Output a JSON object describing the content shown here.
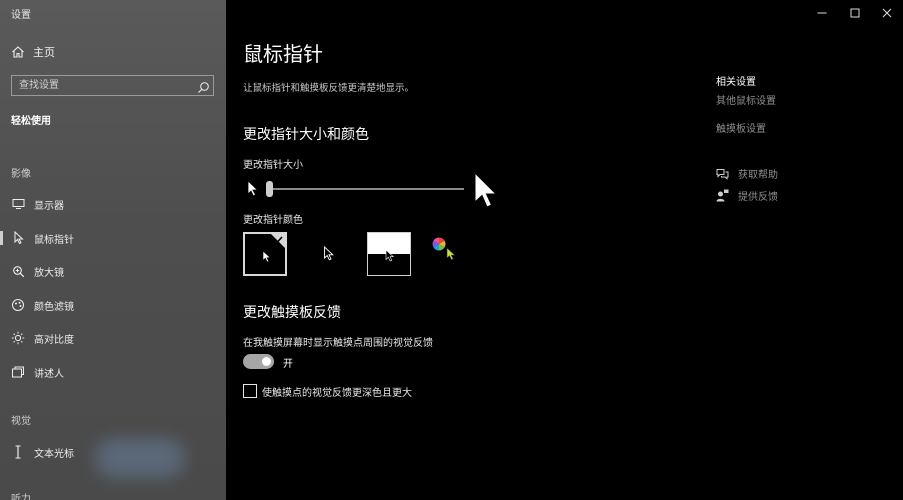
{
  "window": {
    "title": "设置",
    "controls": {
      "minimize": "minimize-icon",
      "maximize": "maximize-icon",
      "close": "close-icon"
    }
  },
  "sidebar": {
    "home": "主页",
    "search_placeholder": "查找设置",
    "section": "轻松使用",
    "groups": [
      {
        "label": "影像",
        "items": [
          {
            "label": "显示器",
            "icon": "monitor-icon"
          },
          {
            "label": "鼠标指针",
            "icon": "mouse-pointer-icon",
            "active": true
          },
          {
            "label": "放大镜",
            "icon": "magnifier-icon"
          },
          {
            "label": "颜色滤镜",
            "icon": "color-filter-icon"
          },
          {
            "label": "高对比度",
            "icon": "high-contrast-icon"
          },
          {
            "label": "讲述人",
            "icon": "narrator-icon"
          }
        ]
      },
      {
        "label": "视觉",
        "items": [
          {
            "label": "文本光标",
            "icon": "text-cursor-icon"
          }
        ]
      },
      {
        "label": "听力",
        "items": []
      }
    ]
  },
  "main": {
    "title": "鼠标指针",
    "description": "让鼠标指针和触摸板反馈更清楚地显示。",
    "size_section": {
      "heading": "更改指针大小和颜色",
      "size_label": "更改指针大小",
      "size_level": 0.0,
      "color_label": "更改指针颜色",
      "color_options": [
        {
          "name": "white",
          "selected": true
        },
        {
          "name": "black",
          "selected": false
        },
        {
          "name": "inverted",
          "selected": false
        },
        {
          "name": "custom",
          "selected": false
        }
      ]
    },
    "touch_section": {
      "heading": "更改触摸板反馈",
      "toggle_label": "在我触摸屏幕时显示触摸点周围的视觉反馈",
      "toggle_state": "开",
      "toggle_on": true,
      "checkbox_label": "使触摸点的视觉反馈更深色且更大",
      "checkbox_checked": false
    }
  },
  "related": {
    "title": "相关设置",
    "links": [
      "其他鼠标设置",
      "触摸板设置"
    ],
    "help": "获取帮助",
    "feedback": "提供反馈"
  },
  "colors": {
    "sidebar_bg": "#4e4e4e",
    "main_bg": "#000000",
    "link": "#8f8f8f",
    "accent_option": "#c5e13a"
  }
}
